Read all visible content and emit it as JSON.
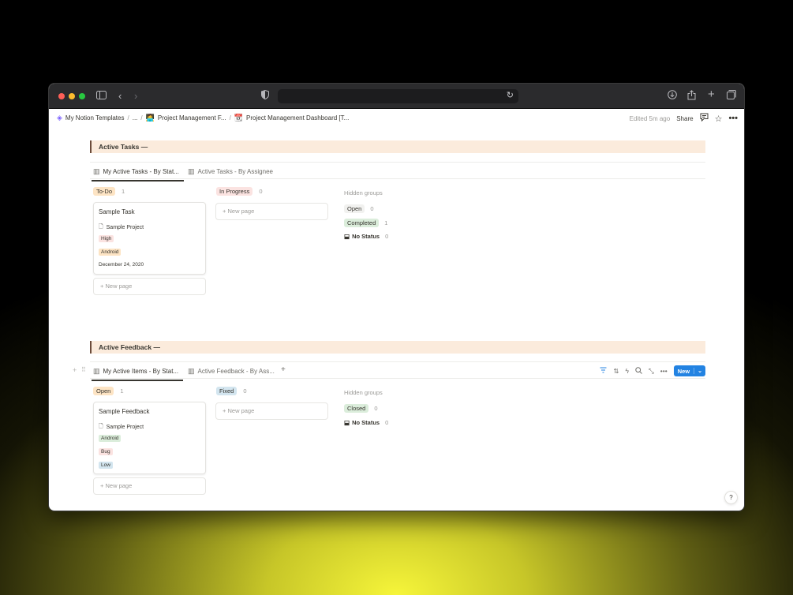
{
  "breadcrumb": {
    "items": [
      "My Notion Templates",
      "...",
      "Project Management F...",
      "Project Management Dashboard [T..."
    ],
    "separator": "/"
  },
  "header": {
    "edited": "Edited 5m ago",
    "share": "Share"
  },
  "active_tasks": {
    "title": "Active Tasks",
    "toggle_mark": "—",
    "tabs": [
      "My Active Tasks - By Stat...",
      "Active Tasks - By Assignee"
    ],
    "groups": [
      {
        "label": "To-Do",
        "count": "1"
      },
      {
        "label": "In Progress",
        "count": "0"
      }
    ],
    "card": {
      "title": "Sample Task",
      "project": "Sample Project",
      "tags": [
        "High",
        "Android"
      ],
      "date": "December 24, 2020"
    },
    "new_page": "New page",
    "hidden": {
      "title": "Hidden groups",
      "rows": [
        {
          "label": "Open",
          "count": "0"
        },
        {
          "label": "Completed",
          "count": "1"
        },
        {
          "label": "No Status",
          "count": "0"
        }
      ]
    }
  },
  "active_feedback": {
    "title": "Active Feedback",
    "toggle_mark": "—",
    "tabs": [
      "My Active Items - By Stat...",
      "Active Feedback - By Ass..."
    ],
    "add_tab": "+",
    "new_button": "New",
    "groups": [
      {
        "label": "Open",
        "count": "1"
      },
      {
        "label": "Fixed",
        "count": "0"
      }
    ],
    "card": {
      "title": "Sample Feedback",
      "project": "Sample Project",
      "tags": [
        "Android",
        "Bug",
        "Low"
      ]
    },
    "new_page": "New page",
    "hidden": {
      "title": "Hidden groups",
      "rows": [
        {
          "label": "Closed",
          "count": "0"
        },
        {
          "label": "No Status",
          "count": "0"
        }
      ]
    }
  },
  "help": "?",
  "colors": {
    "section_bg": "#fbebdc",
    "accent_blue": "#2383e2",
    "todo": "#fde4c4",
    "in_progress": "#fbe3e1",
    "open": "#f1f1ef",
    "completed": "#dbeddb",
    "fixed": "#d3e5ef"
  }
}
